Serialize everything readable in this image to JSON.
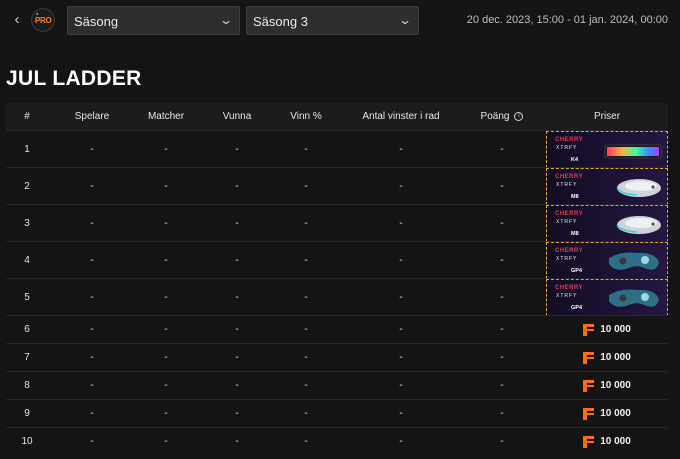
{
  "topbar": {
    "back_icon": "chevron-left-icon",
    "logo_text": "PRO",
    "season_filter": {
      "label": "Säsong",
      "icon": "chevron-down-icon"
    },
    "season_select": {
      "value": "Säsong 3",
      "icon": "chevron-down-icon"
    },
    "date_range": "20 dec. 2023, 15:00 - 01 jan. 2024, 00:00"
  },
  "page": {
    "title": "JUL LADDER"
  },
  "table": {
    "headers": {
      "rank": "#",
      "player": "Spelare",
      "matches": "Matcher",
      "won": "Vunna",
      "win_pct": "Vinn %",
      "streak": "Antal vinster i rad",
      "points": "Poäng",
      "prizes": "Priser"
    },
    "rows": [
      {
        "rank": "1",
        "player": "-",
        "matches": "-",
        "won": "-",
        "win_pct": "-",
        "streak": "-",
        "points": "-",
        "prize_brand": "CHERRY",
        "prize_brand2": "XTRFY",
        "prize_model": "K4"
      },
      {
        "rank": "2",
        "player": "-",
        "matches": "-",
        "won": "-",
        "win_pct": "-",
        "streak": "-",
        "points": "-",
        "prize_brand": "CHERRY",
        "prize_brand2": "XTRFY",
        "prize_model": "M8"
      },
      {
        "rank": "3",
        "player": "-",
        "matches": "-",
        "won": "-",
        "win_pct": "-",
        "streak": "-",
        "points": "-",
        "prize_brand": "CHERRY",
        "prize_brand2": "XTRFY",
        "prize_model": "M8"
      },
      {
        "rank": "4",
        "player": "-",
        "matches": "-",
        "won": "-",
        "win_pct": "-",
        "streak": "-",
        "points": "-",
        "prize_brand": "CHERRY",
        "prize_brand2": "XTRFY",
        "prize_model": "GP4"
      },
      {
        "rank": "5",
        "player": "-",
        "matches": "-",
        "won": "-",
        "win_pct": "-",
        "streak": "-",
        "points": "-",
        "prize_brand": "CHERRY",
        "prize_brand2": "XTRFY",
        "prize_model": "GP4"
      },
      {
        "rank": "6",
        "player": "-",
        "matches": "-",
        "won": "-",
        "win_pct": "-",
        "streak": "-",
        "points": "-",
        "prize_amount": "10 000"
      },
      {
        "rank": "7",
        "player": "-",
        "matches": "-",
        "won": "-",
        "win_pct": "-",
        "streak": "-",
        "points": "-",
        "prize_amount": "10 000"
      },
      {
        "rank": "8",
        "player": "-",
        "matches": "-",
        "won": "-",
        "win_pct": "-",
        "streak": "-",
        "points": "-",
        "prize_amount": "10 000"
      },
      {
        "rank": "9",
        "player": "-",
        "matches": "-",
        "won": "-",
        "win_pct": "-",
        "streak": "-",
        "points": "-",
        "prize_amount": "10 000"
      },
      {
        "rank": "10",
        "player": "-",
        "matches": "-",
        "won": "-",
        "win_pct": "-",
        "streak": "-",
        "points": "-",
        "prize_amount": "10 000"
      }
    ]
  },
  "colors": {
    "background": "#141414",
    "accent": "#ff6a14",
    "prize_border": "#e0a92a",
    "brand_red": "#e23a55"
  }
}
